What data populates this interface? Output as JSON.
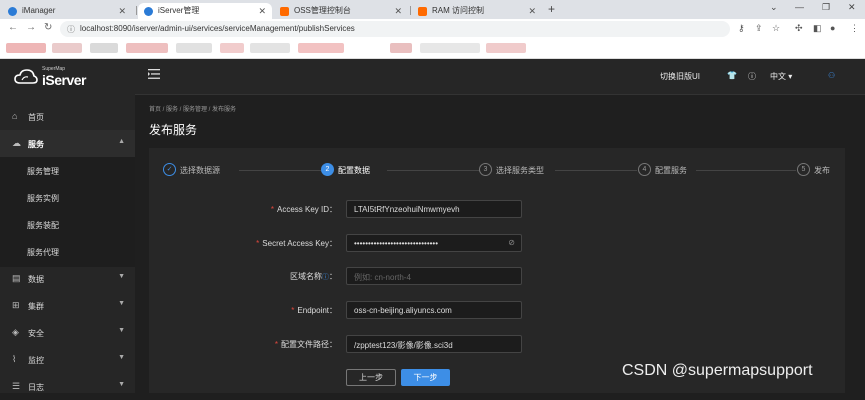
{
  "browser": {
    "tabs": [
      {
        "label": "iManager",
        "icon": "imanager-favicon",
        "color": "#2b7bd6"
      },
      {
        "label": "iServer管理",
        "icon": "iserver-favicon",
        "color": "#2b7bd6"
      },
      {
        "label": "OSS管理控制台",
        "icon": "aliyun-favicon",
        "color": "#ff6a00"
      },
      {
        "label": "RAM 访问控制",
        "icon": "aliyun-favicon",
        "color": "#ff6a00"
      }
    ],
    "url": "localhost:8090/iserver/admin-ui/services/serviceManagement/publishServices"
  },
  "header": {
    "logo_small": "SuperMap",
    "logo_big": "iServer",
    "switch_ui": "切换旧版UI",
    "language": "中文 ▾"
  },
  "sidebar": {
    "items": [
      {
        "label": "首页",
        "icon": "home-icon",
        "glyph": "⌂"
      },
      {
        "label": "服务",
        "icon": "cloud-icon",
        "glyph": "☁",
        "chevron": "▲"
      },
      {
        "label": "服务管理"
      },
      {
        "label": "服务实例"
      },
      {
        "label": "服务装配"
      },
      {
        "label": "服务代理"
      },
      {
        "label": "数据",
        "icon": "data-icon",
        "glyph": "▤",
        "chevron": "▼"
      },
      {
        "label": "集群",
        "icon": "cluster-icon",
        "glyph": "⊞",
        "chevron": "▼"
      },
      {
        "label": "安全",
        "icon": "shield-icon",
        "glyph": "◈",
        "chevron": "▼"
      },
      {
        "label": "监控",
        "icon": "monitor-icon",
        "glyph": "⌇",
        "chevron": "▼"
      },
      {
        "label": "日志",
        "icon": "log-icon",
        "glyph": "☰",
        "chevron": "▼"
      }
    ]
  },
  "main": {
    "breadcrumb": "首页 / 服务 / 服务管理 / 发布服务",
    "title": "发布服务",
    "steps": [
      {
        "num": "✓",
        "label": "选择数据源",
        "state": "done"
      },
      {
        "num": "2",
        "label": "配置数据",
        "state": "active"
      },
      {
        "num": "3",
        "label": "选择服务类型",
        "state": "pending"
      },
      {
        "num": "4",
        "label": "配置服务",
        "state": "pending"
      },
      {
        "num": "5",
        "label": "发布",
        "state": "pending"
      }
    ],
    "form": {
      "access_key_id": {
        "label": "Access Key ID：",
        "value": "LTAI5tRfYnzeohuiNmwmyevh"
      },
      "secret_access_key": {
        "label": "Secret Access Key：",
        "value": "••••••••••••••••••••••••••••••"
      },
      "region": {
        "label": "区域名称",
        "placeholder": "例如: cn-north-4"
      },
      "endpoint": {
        "label": "Endpoint：",
        "value": "oss-cn-beijing.aliyuncs.com"
      },
      "config_path": {
        "label": "配置文件路径：",
        "value": "/zpptest123/影像/影像.sci3d"
      }
    },
    "prev_button": "上一步",
    "next_button": "下一步"
  },
  "watermark": "CSDN @supermapsupport",
  "colors": {
    "accent": "#3d8ee6",
    "required": "#e0483d",
    "sidebar_bg": "#262626",
    "main_bg": "#1f1f1f"
  }
}
